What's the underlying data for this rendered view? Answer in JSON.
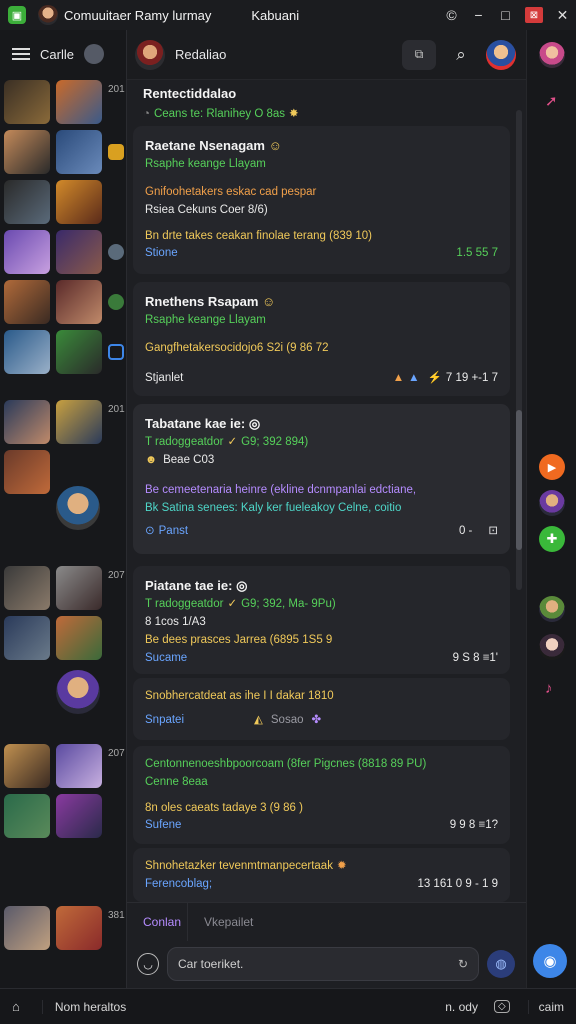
{
  "window": {
    "title": "Comuuitaer Ramy lurmay",
    "subtitle": "Kabuani",
    "icons": [
      "copyright-icon",
      "minimize-icon",
      "maximize-icon",
      "close-icon"
    ]
  },
  "sidebar": {
    "label": "Carlle",
    "time_labels": [
      "201",
      "201",
      "207",
      "207",
      "381"
    ]
  },
  "chat": {
    "contact": "Redaliao",
    "input_hint": "Vkepailet",
    "input_left": "Conlan",
    "composer_placeholder": "Car toeriket."
  },
  "messages": [
    {
      "line1": "Rentectiddalao",
      "line2": "Ceans te: Rlanihey O 8as",
      "line2_color": "#e84b4b"
    },
    {
      "title": "Raetane Nsenagam",
      "subtitle": "Rsaphe keange Llayam",
      "body1": "Gnifoohetakers eskac cad pespar",
      "body2": "Rsiea Cekuns Coer 8/6)",
      "body3": "Bn drte takes ceakan finolae terang (839 10)",
      "footer": "Stione",
      "footer_right": "1.5 55 7"
    },
    {
      "title": "Rnethens Rsapam",
      "subtitle": "Rsaphe keange Llayam",
      "body1": "Gangfhetakersocidojo6 S2i (9 86 72",
      "footer": "Stjanlet",
      "footer_right": "7 19 +-1 7"
    },
    {
      "title": "Tabatane kae ie:",
      "subtitle": "T radoggeatdor",
      "subtitle2": "G9; 392 894)",
      "meta": "Beae C03",
      "body1": "Be cemeetenaria heinre (ekline dcnmpanlai edctiane,",
      "body2": "Bk Satina senees: Kaly ker fueleakoy Celne, coitio",
      "footer": "Panst",
      "footer_right": "0 -"
    },
    {
      "title": "Piatane tae ie:",
      "subtitle": "T radoggeatdor",
      "subtitle2": "G9; 392, Ma- 9Pu)",
      "meta": "8 1cos 1/A3",
      "body1": "Be dees prasces Jarrea (6895 1S5 9",
      "footer": "Sucame",
      "footer_right": "9 S 8 ≡1'"
    },
    {
      "line1": "Snobhercatdeat as ihe I I dakar 1810",
      "footer": "Snpatei",
      "footer_mid": "Sosao"
    },
    {
      "line1": "Centonnenoeshbpoorcoam (8fer Pigcnes (8818 89 PU)",
      "line2": "Cenne 8eaa",
      "body1": "8n oles caeats tadaye 3 (9 86 )",
      "footer": "Sufene",
      "footer_right": "9 9 8 ≡1?"
    },
    {
      "line1": "Shnohetazker tevenmtmanpecertaak",
      "footer": "Ferencoblag;",
      "footer_right": "13 161 0 9 - 1 9"
    }
  ],
  "bottom": {
    "left": "Nom heraltos",
    "right1": "n. ody",
    "right2": "caim"
  },
  "colors": {
    "accent": "#3d86e8",
    "green": "#56d05a",
    "yellow": "#f0c95a",
    "orange": "#f1a04a",
    "blue": "#6aa5ff"
  }
}
